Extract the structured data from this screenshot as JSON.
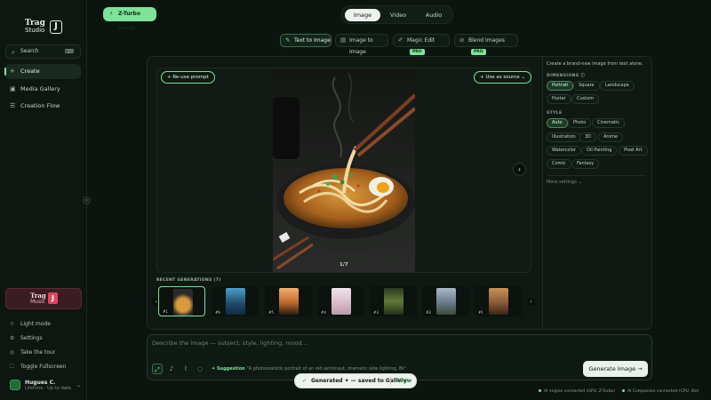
{
  "brand": {
    "logo_word": "Trag",
    "logo_sub": "Studio",
    "logo_mark": "J"
  },
  "sidebar": {
    "search_label": "Search",
    "items": [
      {
        "label": "Create",
        "icon": "plus-icon",
        "active": true
      },
      {
        "label": "Media Gallery",
        "icon": "image-icon",
        "active": false
      },
      {
        "label": "Creation Flow",
        "icon": "flow-icon",
        "active": false
      }
    ],
    "promo": {
      "word": "Trag",
      "sub": "Music",
      "mark": "J"
    },
    "bottom_items": [
      {
        "label": "Light mode",
        "icon": "sun-icon"
      },
      {
        "label": "Settings",
        "icon": "gear-icon"
      },
      {
        "label": "Take the tour",
        "icon": "compass-icon"
      },
      {
        "label": "Toggle Fullscreen",
        "icon": "fullscreen-icon"
      }
    ],
    "user": {
      "name": "Hugues C.",
      "subtitle": "Lifetime · Up-to-date"
    }
  },
  "status_pill": "Z-Turbo ready",
  "modes": [
    "Image",
    "Video",
    "Audio"
  ],
  "active_mode": "Image",
  "tools": [
    {
      "label": "Text to Image",
      "badge": "",
      "selected": true
    },
    {
      "label": "Image to Image",
      "badge": "",
      "selected": false
    },
    {
      "label": "Magic Edit",
      "badge": "PRO",
      "selected": false
    },
    {
      "label": "Blend Images",
      "badge": "PRO",
      "selected": false
    }
  ],
  "viewer": {
    "reuse_prompt": "Re-use prompt",
    "use_as_source": "Use as source",
    "counter": "1/7"
  },
  "recent": {
    "label": "RECENT GENERATIONS (7)",
    "items": [
      {
        "n": "#1",
        "color": "#6b4a2a"
      },
      {
        "n": "#6",
        "color": "#2c6a8a"
      },
      {
        "n": "#5",
        "color": "#c07a3a"
      },
      {
        "n": "#4",
        "color": "#d7c0c8"
      },
      {
        "n": "#3",
        "color": "#4f6a3a"
      },
      {
        "n": "#2",
        "color": "#7a8aa0"
      },
      {
        "n": "#1",
        "color": "#8a5a3a"
      }
    ]
  },
  "settings": {
    "description": "Create a brand-new image from text alone.",
    "dimensions_label": "DIMENSIONS",
    "dimensions": [
      "Portrait",
      "Square",
      "Landscape",
      "Poster",
      "Custom"
    ],
    "selected_dimension": "Portrait",
    "style_label": "STYLE",
    "styles": [
      "Auto",
      "Photo",
      "Cinematic",
      "Illustration",
      "3D",
      "Anime",
      "Watercolor",
      "Oil Painting",
      "Pixel Art",
      "Comic",
      "Fantasy"
    ],
    "selected_style": "Auto",
    "more_settings": "More settings"
  },
  "prompt": {
    "placeholder": "Describe the image — subject, style, lighting, mood...",
    "suggestion_label": "Suggestion",
    "suggestion_text": "\"A photorealistic portrait of an old astronaut, dramatic side lighting, 8k\"",
    "generate_label": "Generate Image"
  },
  "toast": {
    "text": "Generated ✦ — saved to Gallery",
    "action": "View"
  },
  "footer": {
    "left": "AI engine connected (GPU, Z-Turbo)",
    "right": "AI Companion connected (CPU, lite)"
  },
  "colors": {
    "accent": "#7ee29b",
    "background": "#0c1410",
    "panel": "#0f1813"
  }
}
